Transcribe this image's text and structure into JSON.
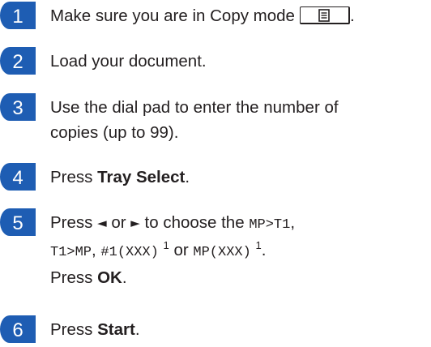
{
  "accent_color": "#1e5db3",
  "copy_key_icon": "copy-mode-icon",
  "steps": [
    {
      "number": "1",
      "text": "Make sure you are in Copy mode",
      "end": "."
    },
    {
      "number": "2",
      "text": "Load your document."
    },
    {
      "number": "3",
      "line1": "Use the dial pad to enter the number of",
      "line2": "copies (up to 99)."
    },
    {
      "number": "4",
      "pre": "Press ",
      "bold": "Tray Select",
      "post": "."
    },
    {
      "number": "5",
      "pre": "Press ",
      "left_arrow": "◄",
      "or1": " or ",
      "right_arrow": "►",
      "mid": " to choose the ",
      "opt1": "MP>T1",
      "comma1": ",",
      "opt2": "T1>MP",
      "comma2": ", ",
      "opt3": "#1(XXX)",
      "footnote1": "1",
      "or2": " or ",
      "opt4": "MP(XXX)",
      "footnote2": "1",
      "end": ".",
      "line3_pre": "Press ",
      "line3_bold": "OK",
      "line3_post": "."
    },
    {
      "number": "6",
      "pre": "Press ",
      "bold": "Start",
      "post": "."
    }
  ]
}
